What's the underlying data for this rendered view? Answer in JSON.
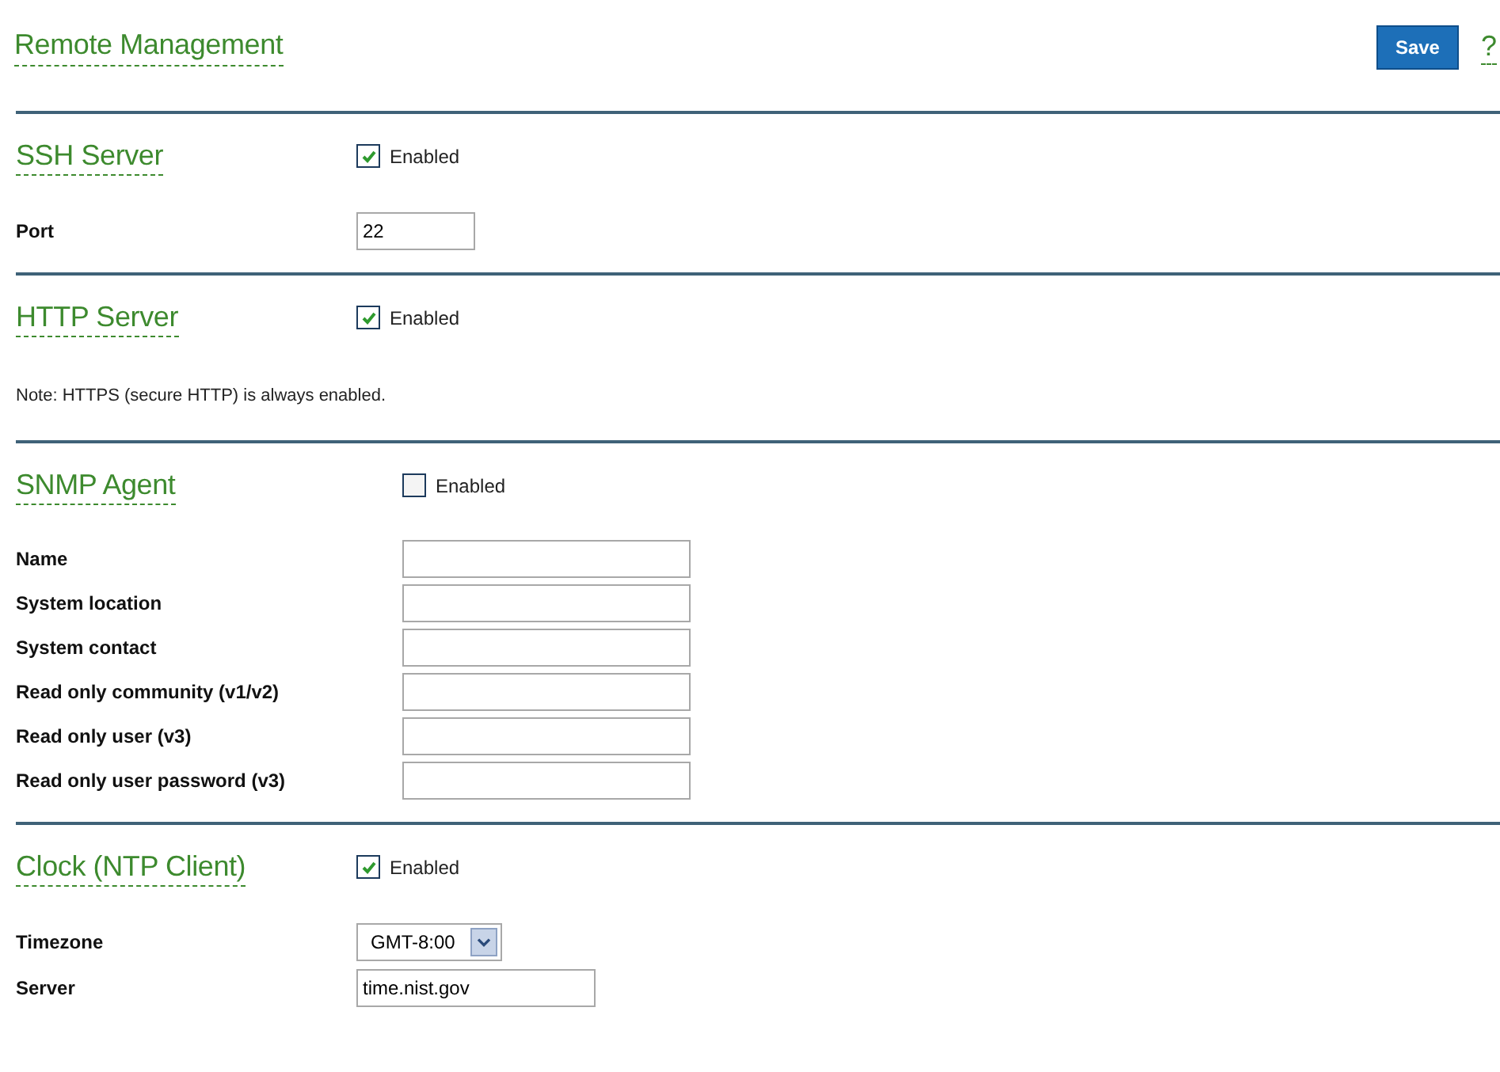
{
  "page": {
    "title": "Remote Management",
    "save_button": "Save",
    "help": "?"
  },
  "sections": [
    {
      "title": "SSH Server",
      "enabled_label": "Enabled",
      "enabled": true,
      "items": [
        {
          "kind": "short_field",
          "label": "Port",
          "value": "22"
        }
      ]
    },
    {
      "title": "HTTP Server",
      "enabled_label": "Enabled",
      "enabled": true,
      "items": [
        {
          "kind": "note",
          "text": "Note: HTTPS (secure HTTP) is always enabled."
        }
      ]
    },
    {
      "title": "SNMP Agent",
      "enabled_label": "Enabled",
      "enabled": false,
      "items": [
        {
          "kind": "field",
          "label": "Name"
        },
        {
          "kind": "field",
          "label": "System location"
        },
        {
          "kind": "field",
          "label": "System contact"
        },
        {
          "kind": "field",
          "label": "Read only community (v1/v2)"
        },
        {
          "kind": "field",
          "label": "Read only user (v3)"
        },
        {
          "kind": "field",
          "label": "Read only user password (v3)"
        }
      ]
    },
    {
      "title": "Clock (NTP Client)",
      "enabled_label": "Enabled",
      "enabled": true,
      "items": [
        {
          "kind": "select",
          "label": "Timezone",
          "value": "GMT-8:00"
        },
        {
          "kind": "medium_field",
          "label": "Server",
          "value": "time.nist.gov"
        }
      ]
    }
  ]
}
